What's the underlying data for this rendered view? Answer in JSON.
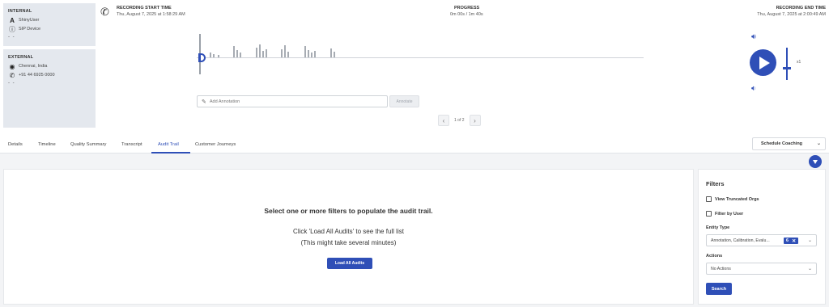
{
  "internal": {
    "title": "INTERNAL",
    "user": "ShinyUser",
    "device": "SIP Device",
    "dash": "- -"
  },
  "external": {
    "title": "EXTERNAL",
    "location": "Chennai, India",
    "phone": "+91 44 6925 0000",
    "dash": "- -"
  },
  "recording": {
    "start_label": "RECORDING START TIME",
    "start_value": "Thu, August 7, 2025 at 1:58:29 AM",
    "progress_label": "PROGRESS",
    "progress_value": "0m 00s / 1m 40s",
    "progress_fraction": 0,
    "end_label": "RECORDING END TIME",
    "end_value": "Thu, August 7, 2025 at 2:00:49 AM"
  },
  "annotation": {
    "placeholder": "Add Annotation",
    "button": "Annotate"
  },
  "pager": {
    "text": "1 of 2",
    "prev": "‹",
    "next": "›"
  },
  "player": {
    "speed": "x1"
  },
  "tabs": [
    {
      "label": "Details"
    },
    {
      "label": "Timeline"
    },
    {
      "label": "Quality Summary"
    },
    {
      "label": "Transcript"
    },
    {
      "label": "Audit Trail"
    },
    {
      "label": "Customer Journeys"
    }
  ],
  "active_tab": "Audit Trail",
  "schedule_button": "Schedule Coaching",
  "audit": {
    "message": "Select one or more filters to populate the audit trail.",
    "load_hint": "Click 'Load All Audits' to see the full list",
    "time_hint": "(This might take several minutes)",
    "load_button": "Load All Audits"
  },
  "filters": {
    "title": "Filters",
    "view_truncated": "View Truncated Orgs",
    "filter_by_user": "Filter by User",
    "entity_type_label": "Entity Type",
    "entity_type_value": "Annotation, Calibration, Evalu...",
    "entity_count": "6",
    "actions_label": "Actions",
    "actions_value": "No Actions",
    "search_button": "Search"
  },
  "colors": {
    "accent": "#2f4fb7",
    "panel": "#e4e8ee"
  }
}
